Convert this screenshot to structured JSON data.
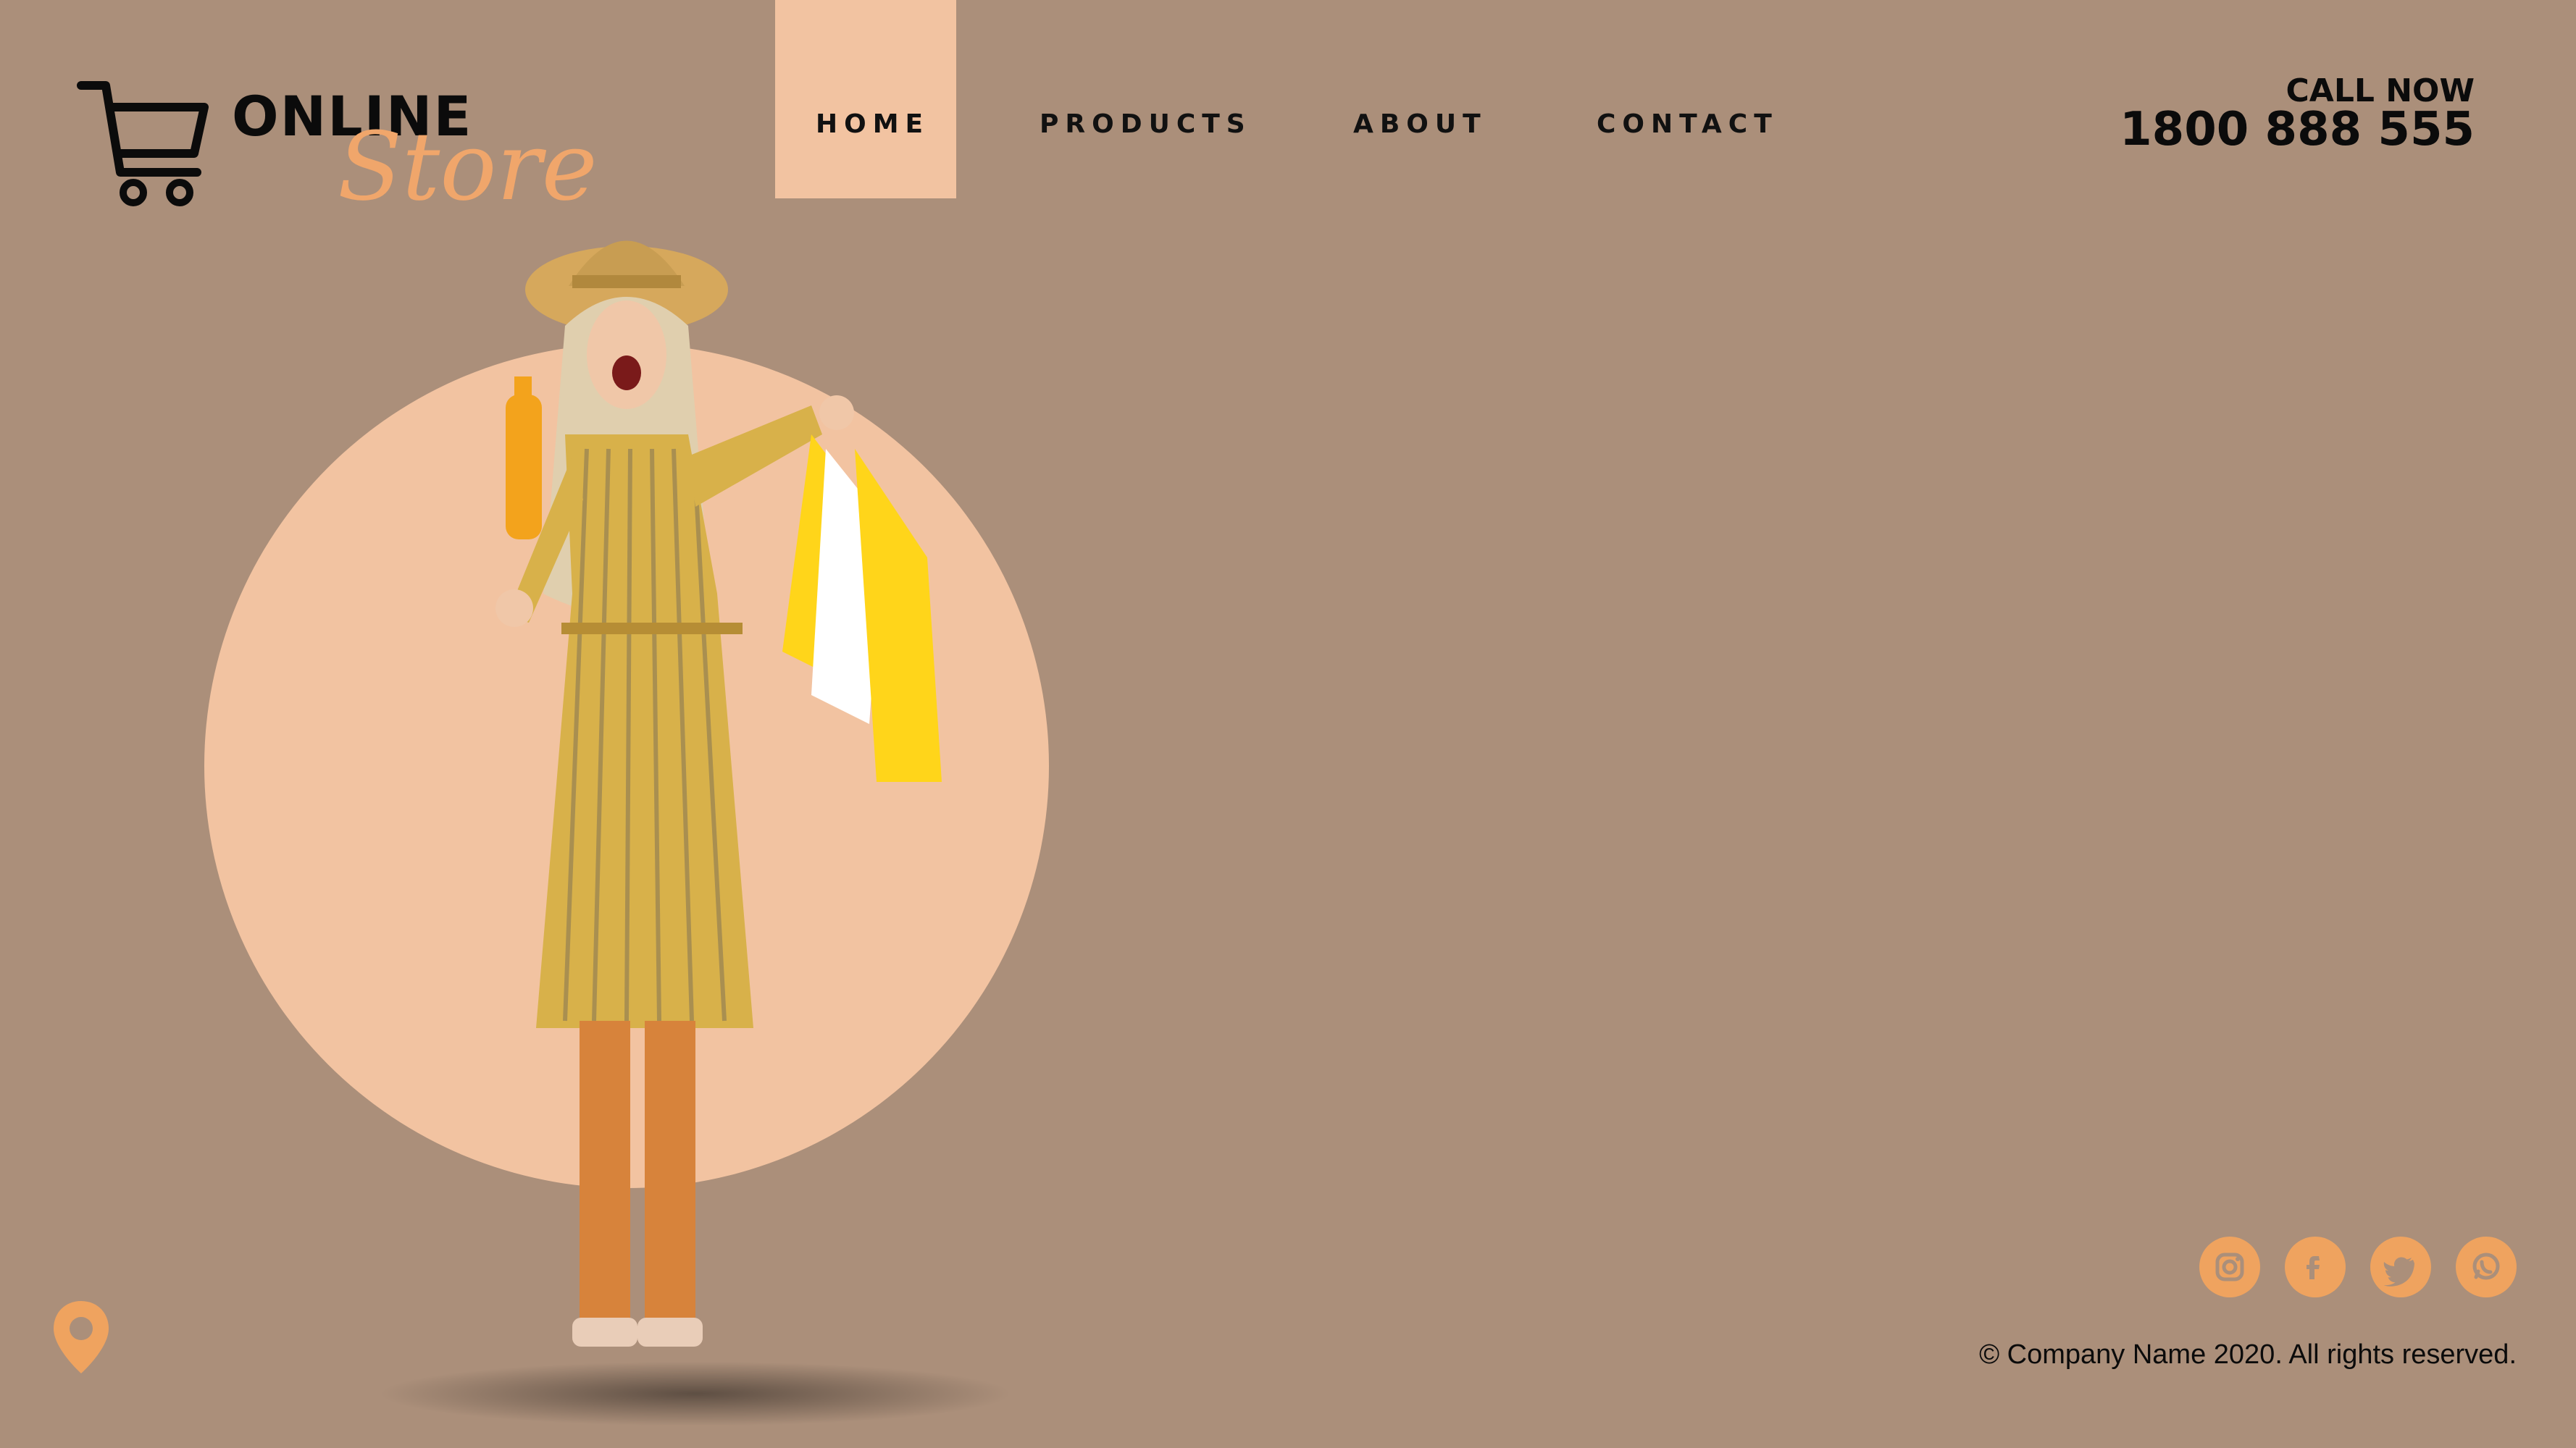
{
  "brand": {
    "primary": "ONLINE",
    "script": "Store",
    "accent_color": "#f0a66b",
    "background_color": "#ab8f7a",
    "highlight_color": "#f2c3a1"
  },
  "nav": {
    "items": [
      {
        "label": "HOME",
        "active": true
      },
      {
        "label": "PRODUCTS",
        "active": false
      },
      {
        "label": "ABOUT",
        "active": false
      },
      {
        "label": "CONTACT",
        "active": false
      }
    ]
  },
  "call": {
    "title": "CALL NOW",
    "number": "1800 888 555"
  },
  "hero": {
    "image": "woman-with-shopping-bags"
  },
  "footer": {
    "socials": [
      "instagram-icon",
      "facebook-icon",
      "twitter-icon",
      "whatsapp-icon"
    ],
    "copyright": "© Company Name 2020. All rights reserved.",
    "location_icon": "location-pin-icon"
  }
}
